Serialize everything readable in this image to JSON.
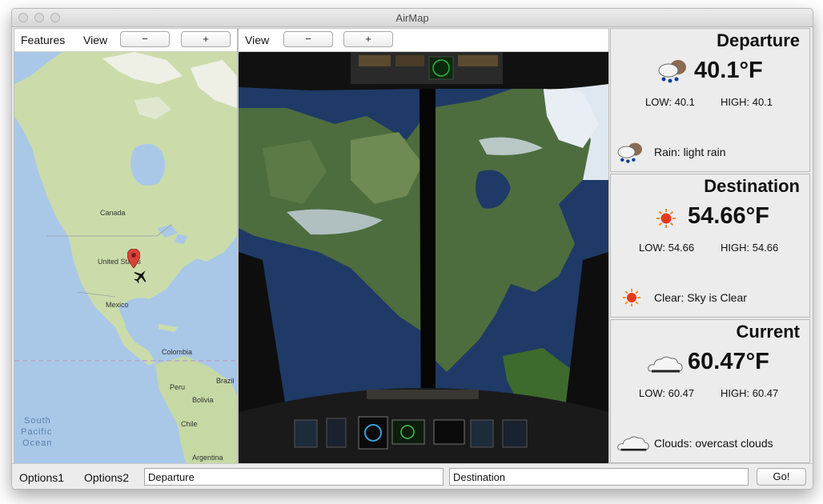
{
  "window": {
    "title": "AirMap"
  },
  "map_panel": {
    "menus": [
      "Features",
      "View"
    ],
    "zoom_out": "−",
    "zoom_in": "+",
    "labels": {
      "canada": "Canada",
      "united_states": "United States",
      "mexico": "Mexico",
      "colombia": "Colombia",
      "peru": "Peru",
      "brazil": "Brazil",
      "bolivia": "Bolivia",
      "chile": "Chile",
      "argentina": "Argentina",
      "south_pacific_1": "South",
      "south_pacific_2": "Pacific",
      "south_pacific_3": "Ocean"
    }
  },
  "view_panel": {
    "menu": "View",
    "zoom_out": "−",
    "zoom_in": "+"
  },
  "weather": {
    "departure": {
      "title": "Departure",
      "temp": "40.1°F",
      "low": "LOW: 40.1",
      "high": "HIGH: 40.1",
      "desc": "Rain: light rain",
      "icon": "rain-cloud-icon"
    },
    "destination": {
      "title": "Destination",
      "temp": "54.66°F",
      "low": "LOW: 54.66",
      "high": "HIGH: 54.66",
      "desc": "Clear: Sky is Clear",
      "icon": "sun-icon"
    },
    "current": {
      "title": "Current",
      "temp": "60.47°F",
      "low": "LOW: 60.47",
      "high": "HIGH: 60.47",
      "desc": "Clouds: overcast clouds",
      "icon": "cloud-icon"
    }
  },
  "bottom": {
    "options1": "Options1",
    "options2": "Options2",
    "departure_value": "Departure",
    "destination_value": "Destination",
    "go": "Go!"
  },
  "colors": {
    "accent_pin": "#d9423a",
    "map_land": "#c9dca8",
    "map_water": "#a8c7e6",
    "sun": "#e53b1c"
  }
}
